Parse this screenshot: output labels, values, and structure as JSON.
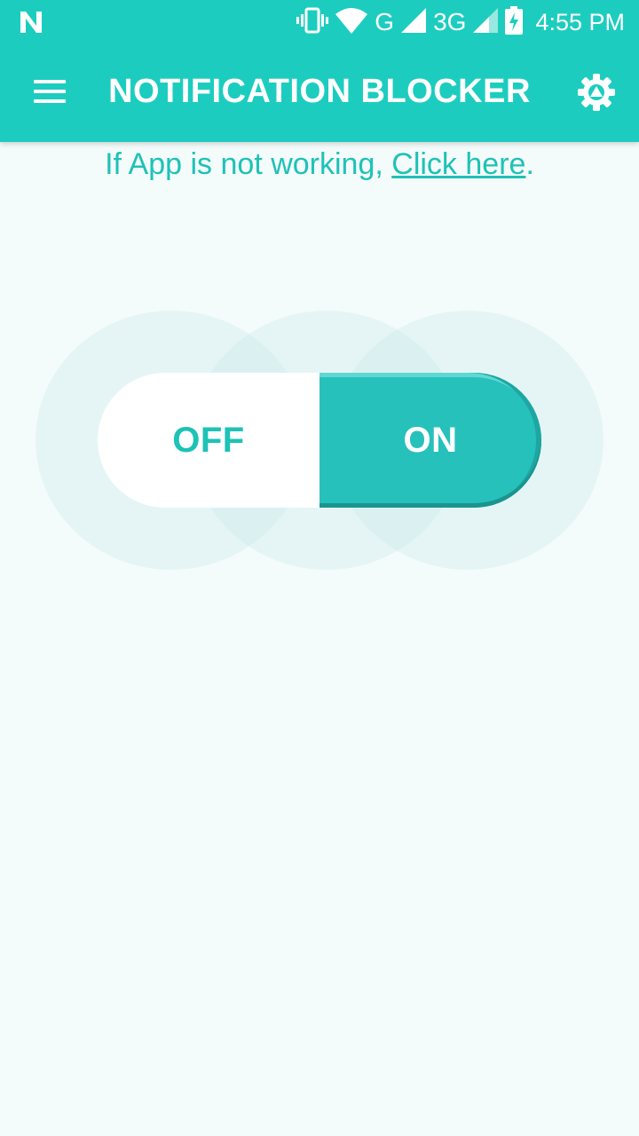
{
  "status_bar": {
    "network_type_1": "G",
    "network_type_2": "3G",
    "time": "4:55 PM",
    "icons": [
      "n-notification-icon",
      "vibrate-icon",
      "wifi-icon",
      "signal-icon",
      "signal-icon",
      "battery-charging-icon"
    ]
  },
  "app_bar": {
    "title": "NOTIFICATION BLOCKER",
    "menu_icon": "hamburger-menu-icon",
    "settings_icon": "gear-icon"
  },
  "help": {
    "prefix": "If App is not working, ",
    "link": "Click here",
    "suffix": "."
  },
  "toggle": {
    "off_label": "OFF",
    "on_label": "ON",
    "state": "ON"
  },
  "colors": {
    "primary": "#1ccdbf",
    "toggle_on": "#27c1bc",
    "text_accent": "#1ec2b6",
    "background": "#f4fbfb"
  }
}
